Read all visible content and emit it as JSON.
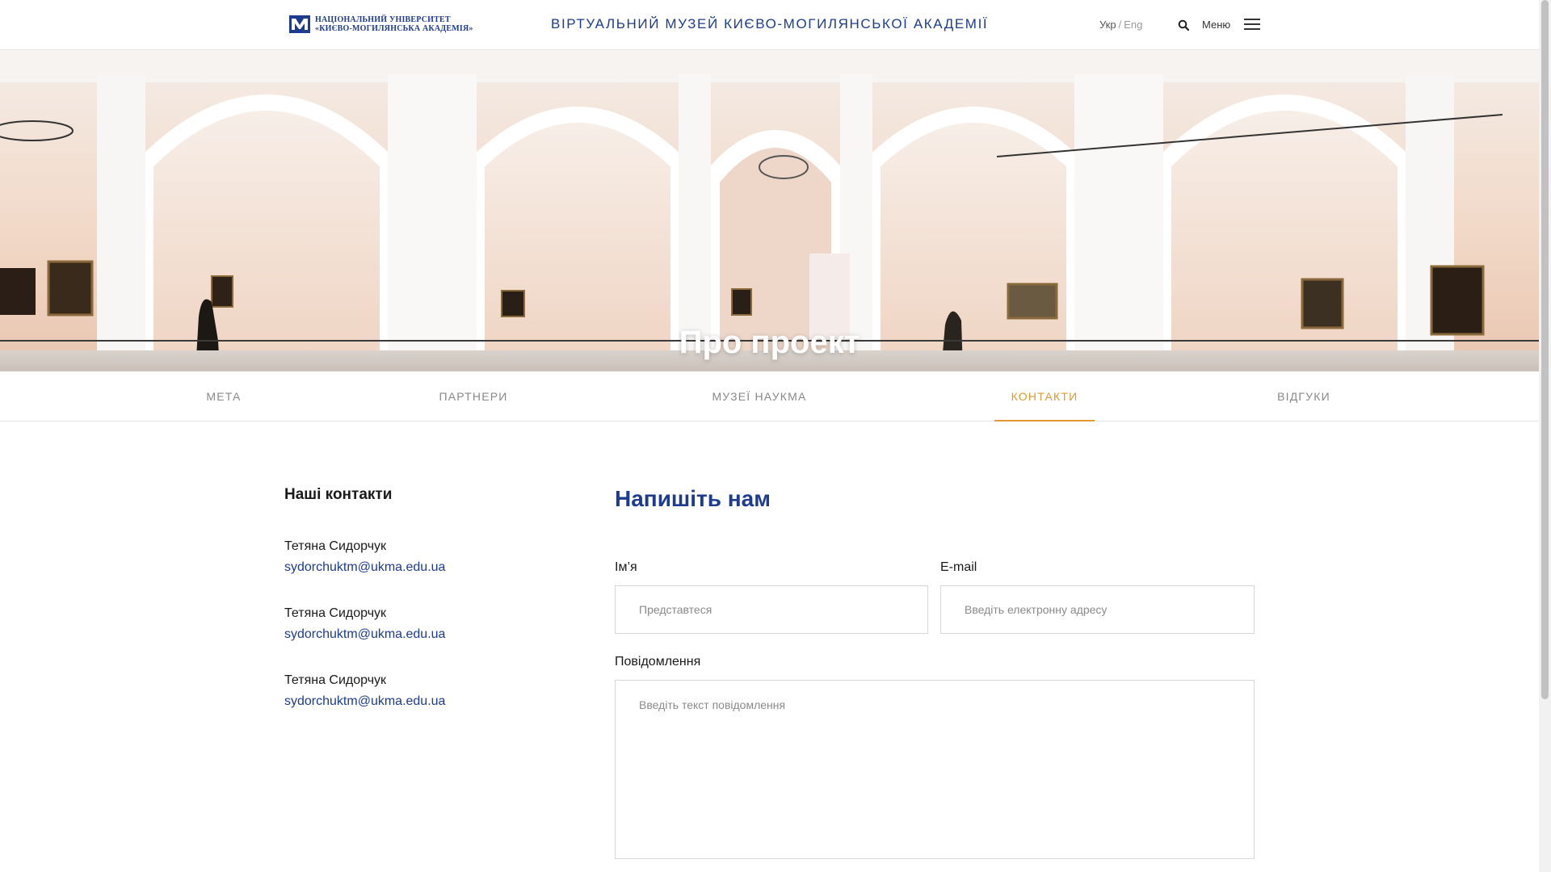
{
  "header": {
    "logo_line1": "НАЦІОНАЛЬНИЙ УНІВЕРСИТЕТ",
    "logo_line2": "«КИЄВО-МОГИЛЯНСЬКА АКАДЕМІЯ»",
    "site_title": "ВІРТУАЛЬНИЙ МУЗЕЙ КИЄВО-МОГИЛЯНСЬКОЇ АКАДЕМІЇ",
    "lang_active": "Укр",
    "lang_separator": "/",
    "lang_other": "Eng",
    "menu_label": "Меню",
    "search_icon": "search-icon",
    "menu_icon": "hamburger-icon"
  },
  "hero": {
    "title": "Про проект"
  },
  "tabs": [
    {
      "label": "МЕТА",
      "active": false
    },
    {
      "label": "ПАРТНЕРИ",
      "active": false
    },
    {
      "label": "МУЗЕЇ НАУКМА",
      "active": false
    },
    {
      "label": "КОНТАКТИ",
      "active": true
    },
    {
      "label": "ВІДГУКИ",
      "active": false
    }
  ],
  "contacts": {
    "title": "Наші контакти",
    "items": [
      {
        "name": "Тетяна Сидорчук",
        "email": "sydorchuktm@ukma.edu.ua"
      },
      {
        "name": "Тетяна Сидорчук",
        "email": "sydorchuktm@ukma.edu.ua"
      },
      {
        "name": "Тетяна Сидорчук",
        "email": "sydorchuktm@ukma.edu.ua"
      }
    ]
  },
  "form": {
    "title": "Напишіть нам",
    "name_label": "Ім’я",
    "name_placeholder": "Представтеся",
    "email_label": "E-mail",
    "email_placeholder": "Введіть електронну адресу",
    "message_label": "Повідомлення",
    "message_placeholder": "Введіть текст повідомлення"
  },
  "colors": {
    "brand_blue": "#1d3c8f",
    "accent_orange": "#e09a2f"
  }
}
